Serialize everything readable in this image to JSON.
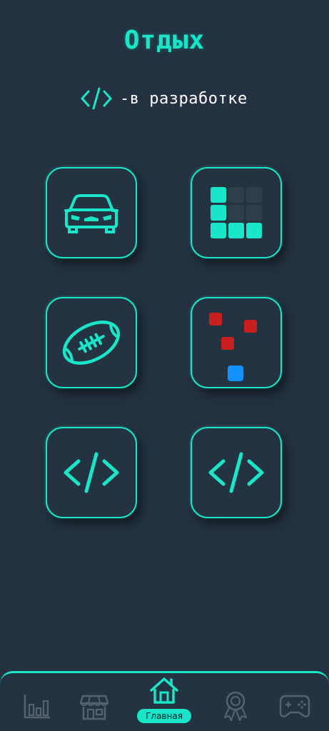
{
  "page": {
    "title": "Отдых"
  },
  "legend": {
    "icon": "code-icon",
    "text": "-в разработке"
  },
  "tiles": [
    {
      "id": "racing-game",
      "icon": "car-icon"
    },
    {
      "id": "block-puzzle-game",
      "icon": "grid-blocks-icon"
    },
    {
      "id": "football-game",
      "icon": "football-icon"
    },
    {
      "id": "dodge-squares-game",
      "icon": "squares-icon"
    },
    {
      "id": "in-development-1",
      "icon": "code-icon"
    },
    {
      "id": "in-development-2",
      "icon": "code-icon"
    }
  ],
  "bottom_nav": {
    "active": "home",
    "items": [
      {
        "id": "stats",
        "icon": "bar-chart-icon"
      },
      {
        "id": "shop",
        "icon": "store-icon"
      },
      {
        "id": "home",
        "icon": "home-icon",
        "label": "Главная"
      },
      {
        "id": "achievements",
        "icon": "award-icon"
      },
      {
        "id": "games",
        "icon": "gamepad-icon"
      }
    ]
  },
  "colors": {
    "background": "#233140",
    "accent": "#19e6c8",
    "inactive": "#56636f",
    "tile_dark": "#2f3d4c",
    "red": "#c8201e",
    "blue": "#1391ff"
  }
}
